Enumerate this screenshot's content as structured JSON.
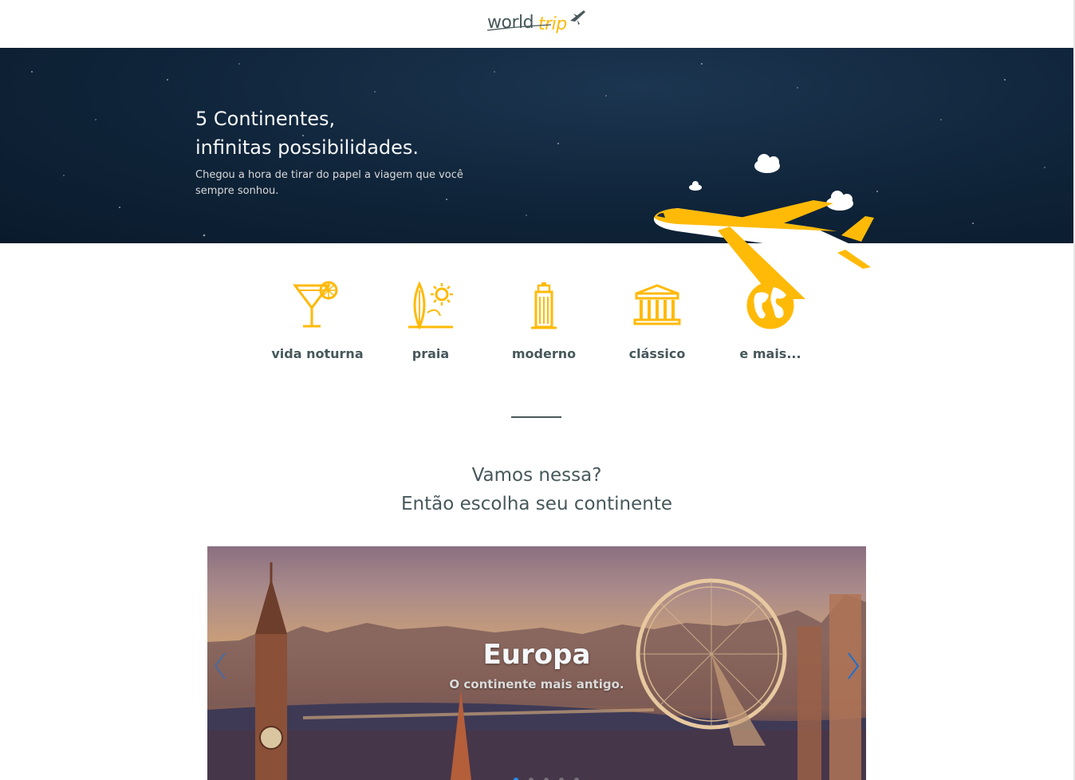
{
  "header": {
    "logo_part1": "world",
    "logo_part2": "trip",
    "logo_icon": "airplane-icon"
  },
  "banner": {
    "title_line1": "5 Continentes,",
    "title_line2": "infinitas possibilidades.",
    "subtitle": "Chegou a hora de tirar do papel a viagem que você sempre sonhou.",
    "illustration": "airplane-with-clouds"
  },
  "categories": [
    {
      "label": "vida noturna",
      "icon": "cocktail-icon"
    },
    {
      "label": "praia",
      "icon": "surf-sun-icon"
    },
    {
      "label": "moderno",
      "icon": "skyscraper-icon"
    },
    {
      "label": "clássico",
      "icon": "museum-icon"
    },
    {
      "label": "e mais...",
      "icon": "globe-icon"
    }
  ],
  "cta": {
    "line1": "Vamos nessa?",
    "line2": "Então escolha seu continente"
  },
  "slider": {
    "slides": [
      {
        "title": "Europa",
        "subtitle": "O continente mais antigo."
      }
    ],
    "active_index": 0,
    "dot_count": 5
  },
  "colors": {
    "accent": "#ffba08",
    "dark_text": "#47585b",
    "light_text": "#f5f8fa",
    "banner_bg": "#0f2439",
    "active_dot": "#1e90ff"
  }
}
